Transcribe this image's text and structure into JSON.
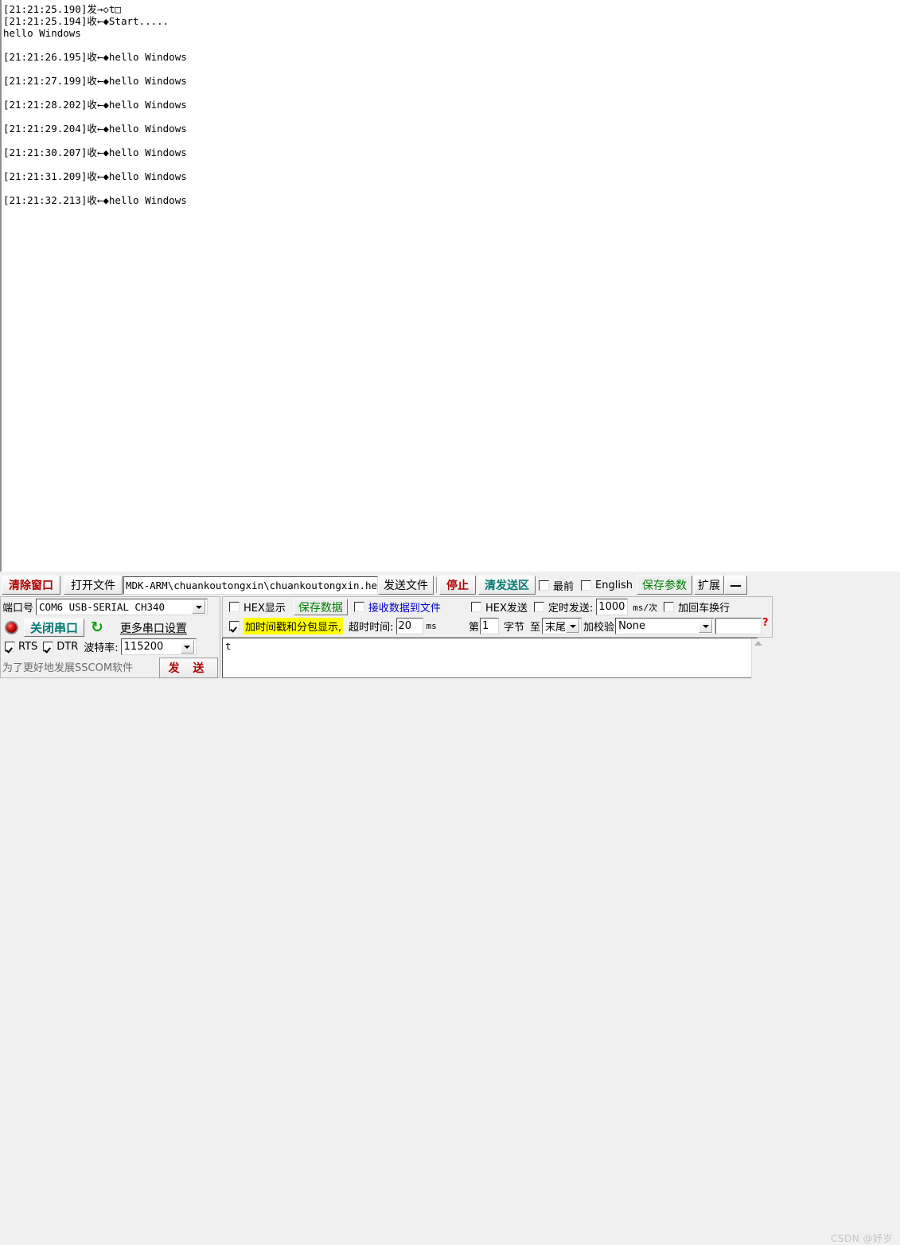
{
  "receive": {
    "lines": [
      {
        "text": "[21:21:25.190]发→◇t□",
        "gap_after": false
      },
      {
        "text": "[21:21:25.194]收←◆Start.....",
        "gap_after": false
      },
      {
        "text": "hello Windows",
        "gap_after": true
      },
      {
        "text": "[21:21:26.195]收←◆hello Windows",
        "gap_after": true
      },
      {
        "text": "[21:21:27.199]收←◆hello Windows",
        "gap_after": true
      },
      {
        "text": "[21:21:28.202]收←◆hello Windows",
        "gap_after": true
      },
      {
        "text": "[21:21:29.204]收←◆hello Windows",
        "gap_after": true
      },
      {
        "text": "[21:21:30.207]收←◆hello Windows",
        "gap_after": true
      },
      {
        "text": "[21:21:31.209]收←◆hello Windows",
        "gap_after": true
      },
      {
        "text": "[21:21:32.213]收←◆hello Windows",
        "gap_after": false
      }
    ]
  },
  "toolbar": {
    "clear_window": "清除窗口",
    "open_file": "打开文件",
    "file_path": "MDK-ARM\\chuankoutongxin\\chuankoutongxin.hex",
    "send_file": "发送文件",
    "stop": "停止",
    "clear_send": "清发送区",
    "topmost_label": "最前",
    "topmost_checked": false,
    "english_label": "English",
    "english_checked": false,
    "save_params": "保存参数",
    "extend": "扩展",
    "minimize": "—"
  },
  "port_panel": {
    "port_label": "端口号",
    "port_value": "COM6 USB-SERIAL CH340",
    "close_port": "关闭串口",
    "refresh_icon": "refresh-icon",
    "more_settings": "更多串口设置",
    "rts_label": "RTS",
    "rts_checked": true,
    "dtr_label": "DTR",
    "dtr_checked": true,
    "baud_label": "波特率:",
    "baud_value": "115200",
    "promo_text": "为了更好地发展SSCOM软件",
    "send_button": "发 送"
  },
  "recv_options": {
    "hex_display_label": "HEX显示",
    "hex_display_checked": false,
    "save_data": "保存数据",
    "recv_to_file_label": "接收数据到文件",
    "recv_to_file_checked": false,
    "timestamp_label": "加时间戳和分包显示,",
    "timestamp_checked": true,
    "timeout_label": "超时时间:",
    "timeout_value": "20",
    "timeout_unit": "ms"
  },
  "send_options": {
    "hex_send_label": "HEX发送",
    "hex_send_checked": false,
    "timed_send_label": "定时发送:",
    "timed_send_checked": false,
    "interval_value": "1000",
    "interval_unit": "ms/次",
    "crlf_label": "加回车换行",
    "crlf_checked": false,
    "help_icon": "question-mark-icon",
    "byte_from_label": "第",
    "byte_from_value": "1",
    "byte_label": "字节",
    "byte_to_label": "至",
    "byte_end_value": "末尾",
    "checksum_label": "加校验",
    "checksum_value": "None"
  },
  "send_area": {
    "content": "t"
  },
  "watermark": {
    "text": "CSDN @妤岁"
  },
  "colors": {
    "clear_window": "#b00000",
    "stop": "#b00000",
    "clear_send": "#007a72",
    "close_port": "#007a72",
    "save_params": "#008000",
    "save_data": "#008000",
    "recv_to_file": "#0000d0",
    "highlight": "#ffff00"
  }
}
